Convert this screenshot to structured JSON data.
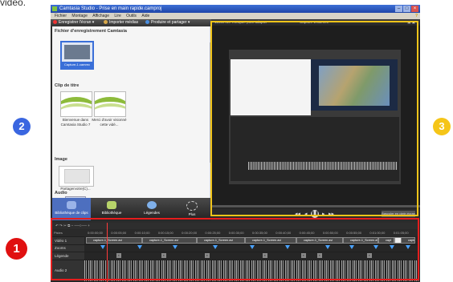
{
  "cutoff_text": "vidéo.",
  "window": {
    "title": "Camtasia Studio - Prise en main rapide.camproj"
  },
  "menubar": [
    "Fichier",
    "Montage",
    "Affichage",
    "Lire",
    "Outils",
    "Aide"
  ],
  "toolbar": {
    "record": "Enregistrer l'écran",
    "import": "Importer médias",
    "produce": "Produire et partager"
  },
  "clip_bin": {
    "recording_section": "Fichier d'enregistrement Camtasia",
    "recording_caption": "Capture-1.camrec",
    "title_section": "Clip de titre",
    "title_clips": [
      "Bienvenue dans Camtasia Studio 7",
      "Merci d'avoir visionné cette vidé..."
    ],
    "image_section": "Image",
    "image_caption": "Partagervotre(C)...",
    "audio_section": "Audio"
  },
  "tabs": [
    "Bibliothèque de clips",
    "Bibliothèque",
    "Légendes",
    "Plus"
  ],
  "preview": {
    "ratio_label": "1280x720 Tronquer pour adapter",
    "clip_label": "Capture-1.camrec",
    "fullscreen": "Basculer en plein écran"
  },
  "timeline": {
    "toolbar_label": "Pistes",
    "time_ticks": [
      "0:00:00;00",
      "0:00:05;00",
      "0:00:10;00",
      "0:00:15;00",
      "0:00:20;00",
      "0:00:25;00",
      "0:00:30;00",
      "0:00:35;00",
      "0:00:40;00",
      "0:00:45;00",
      "0:00:50;00",
      "0:00:55;00",
      "0:01:00;00",
      "0:01:05;00"
    ],
    "tracks": {
      "video": "Vidéo 1",
      "markers": "Zooms",
      "callouts": "Légende",
      "audio": "Audio 2"
    },
    "clips": [
      "capture-1_Screen.avi",
      "capture-1_Screen.avi",
      "capture-1_Screen.avi",
      "capture-1_Screen.avi",
      "capture-1_Screen.avi",
      "capture-1_Screen.avi",
      "capt",
      "capture-1"
    ]
  },
  "badges": [
    "1",
    "2",
    "3"
  ],
  "colors": {
    "red_frame": "#e51d1d",
    "yellow_frame": "#f0c419",
    "blue_badge": "#3a66e0"
  }
}
